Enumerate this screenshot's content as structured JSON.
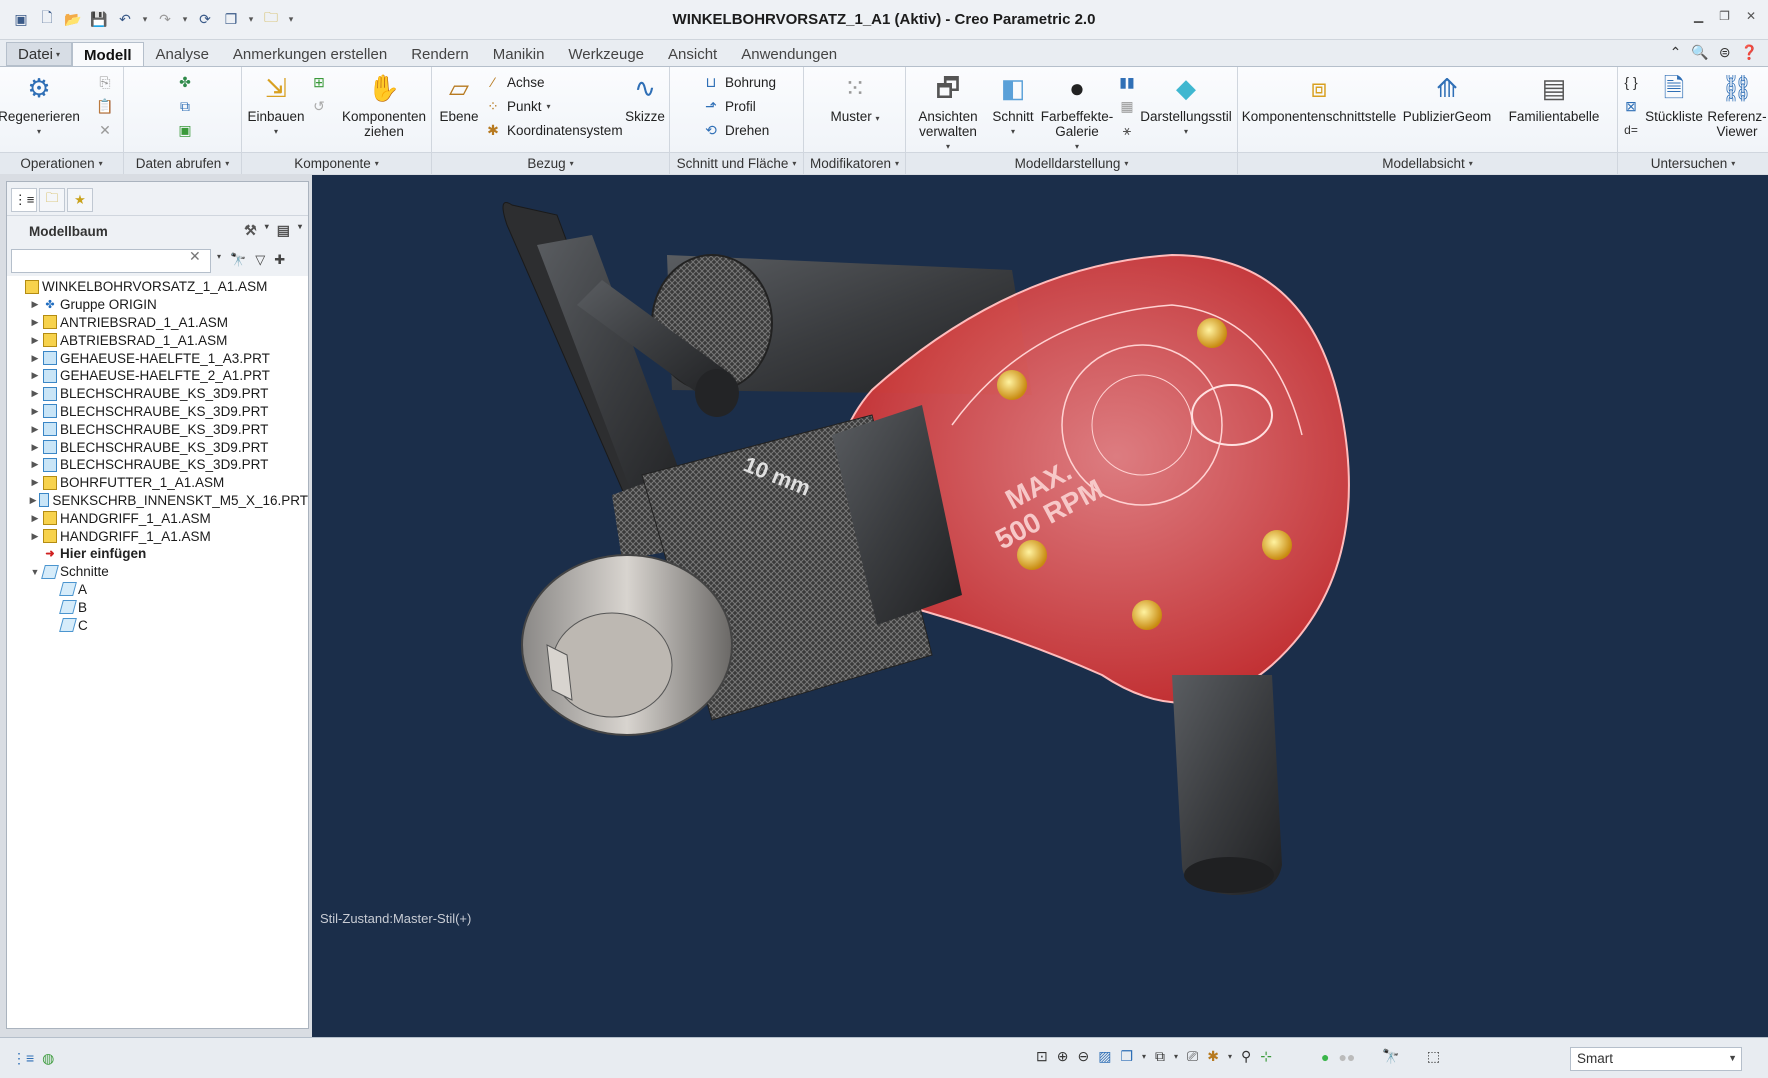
{
  "window": {
    "title": "WINKELBOHRVORSATZ_1_A1 (Aktiv) - Creo Parametric 2.0"
  },
  "tabs": [
    {
      "label": "Datei"
    },
    {
      "label": "Modell"
    },
    {
      "label": "Analyse"
    },
    {
      "label": "Anmerkungen erstellen"
    },
    {
      "label": "Rendern"
    },
    {
      "label": "Manikin"
    },
    {
      "label": "Werkzeuge"
    },
    {
      "label": "Ansicht"
    },
    {
      "label": "Anwendungen"
    }
  ],
  "ribbon": {
    "operationen": {
      "footer": "Operationen",
      "regenerieren": "Regenerieren"
    },
    "daten_abrufen": {
      "footer": "Daten abrufen"
    },
    "komponente": {
      "footer": "Komponente",
      "einbauen": "Einbauen",
      "komponenten_ziehen": "Komponenten ziehen"
    },
    "bezug": {
      "footer": "Bezug",
      "ebene": "Ebene",
      "achse": "Achse",
      "punkt": "Punkt",
      "koordinatensystem": "Koordinatensystem",
      "skizze": "Skizze"
    },
    "schnitt_flaeche": {
      "footer": "Schnitt und Fläche",
      "bohrung": "Bohrung",
      "profil": "Profil",
      "drehen": "Drehen"
    },
    "modifikatoren": {
      "footer": "Modifikatoren",
      "muster": "Muster"
    },
    "modelldarstellung": {
      "footer": "Modelldarstellung",
      "ansichten_verwalten": "Ansichten verwalten",
      "schnitt": "Schnitt",
      "farbeffekte_galerie": "Farbeffekte-Galerie",
      "darstellungsstil": "Darstellungsstil"
    },
    "modellabsicht": {
      "footer": "Modellabsicht",
      "komponentenschnittstelle": "Komponentenschnittstelle",
      "publiziergeom": "PublizierGeom",
      "familientabelle": "Familientabelle"
    },
    "untersuchen": {
      "footer": "Untersuchen",
      "stueckliste": "Stückliste",
      "referenz_viewer": "Referenz-Viewer"
    }
  },
  "modelltree": {
    "header": "Modellbaum",
    "search_value": "",
    "items": [
      {
        "label": "WINKELBOHRVORSATZ_1_A1.ASM",
        "type": "asm",
        "indent": 0,
        "expander": ""
      },
      {
        "label": "Gruppe ORIGIN",
        "type": "group",
        "indent": 1,
        "expander": "▶"
      },
      {
        "label": "ANTRIEBSRAD_1_A1.ASM",
        "type": "asm",
        "indent": 1,
        "expander": "▶"
      },
      {
        "label": "ABTRIEBSRAD_1_A1.ASM",
        "type": "asm",
        "indent": 1,
        "expander": "▶"
      },
      {
        "label": "GEHAEUSE-HAELFTE_1_A3.PRT",
        "type": "prt",
        "indent": 1,
        "expander": "▶"
      },
      {
        "label": "GEHAEUSE-HAELFTE_2_A1.PRT",
        "type": "prt",
        "indent": 1,
        "expander": "▶"
      },
      {
        "label": "BLECHSCHRAUBE_KS_3D9.PRT",
        "type": "prt",
        "indent": 1,
        "expander": "▶"
      },
      {
        "label": "BLECHSCHRAUBE_KS_3D9.PRT",
        "type": "prt",
        "indent": 1,
        "expander": "▶"
      },
      {
        "label": "BLECHSCHRAUBE_KS_3D9.PRT",
        "type": "prt",
        "indent": 1,
        "expander": "▶"
      },
      {
        "label": "BLECHSCHRAUBE_KS_3D9.PRT",
        "type": "prt",
        "indent": 1,
        "expander": "▶"
      },
      {
        "label": "BLECHSCHRAUBE_KS_3D9.PRT",
        "type": "prt",
        "indent": 1,
        "expander": "▶"
      },
      {
        "label": "BOHRFUTTER_1_A1.ASM",
        "type": "asm",
        "indent": 1,
        "expander": "▶"
      },
      {
        "label": "SENKSCHRB_INNENSKT_M5_X_16.PRT",
        "type": "prt",
        "indent": 1,
        "expander": "▶"
      },
      {
        "label": "HANDGRIFF_1_A1.ASM",
        "type": "asm",
        "indent": 1,
        "expander": "▶"
      },
      {
        "label": "HANDGRIFF_1_A1.ASM",
        "type": "asm",
        "indent": 1,
        "expander": "▶"
      },
      {
        "label": "Hier einfügen",
        "type": "insert",
        "indent": 1,
        "expander": ""
      },
      {
        "label": "Schnitte",
        "type": "xsec",
        "indent": 1,
        "expander": "▼"
      },
      {
        "label": "A",
        "type": "xsec",
        "indent": 2,
        "expander": ""
      },
      {
        "label": "B",
        "type": "xsec",
        "indent": 2,
        "expander": ""
      },
      {
        "label": "C",
        "type": "xsec",
        "indent": 2,
        "expander": ""
      }
    ]
  },
  "viewport": {
    "style_state": "Stil-Zustand:Master-Stil(+)",
    "chuck_label": "10 mm",
    "housing_label_1": "MAX.",
    "housing_label_2": "500 RPM",
    "bg_color": "#1b2e4a",
    "housing_color": "#e23a3a"
  },
  "statusbar": {
    "filter": "Smart"
  }
}
